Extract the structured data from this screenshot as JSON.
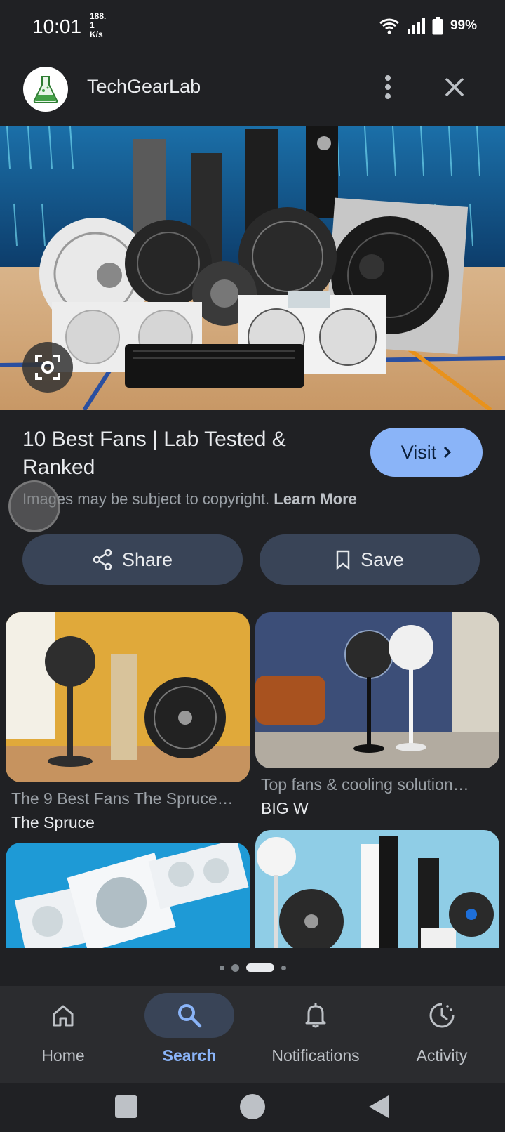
{
  "status_bar": {
    "time": "10:01",
    "net_speed_line1": "188.",
    "net_speed_line2": "1",
    "net_speed_unit": "K/s",
    "battery_percent": "99%"
  },
  "app_bar": {
    "site_name": "TechGearLab"
  },
  "result": {
    "title": "10 Best Fans | Lab Tested & Ranked",
    "visit_label": "Visit",
    "copyright_text": "Images may be subject to copyright.",
    "learn_more_label": "Learn More",
    "share_label": "Share",
    "save_label": "Save"
  },
  "related": [
    {
      "caption": "The 9 Best Fans The Spruce…",
      "source": "The Spruce"
    },
    {
      "caption": "Top fans & cooling solution…",
      "source": "BIG W"
    }
  ],
  "bottom_nav": {
    "items": [
      {
        "label": "Home",
        "icon": "home-icon"
      },
      {
        "label": "Search",
        "icon": "search-icon",
        "active": true
      },
      {
        "label": "Notifications",
        "icon": "bell-icon"
      },
      {
        "label": "Activity",
        "icon": "activity-icon"
      }
    ]
  },
  "colors": {
    "background": "#202124",
    "accent": "#8ab4f8",
    "button_bg": "#394457"
  }
}
